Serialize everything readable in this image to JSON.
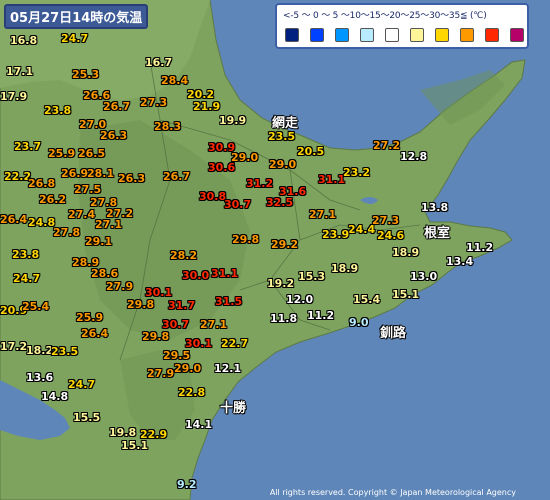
{
  "title": "05月27日14時の気温",
  "legend": {
    "scale_text": "<-5 〜 0 〜 5 〜10〜15〜20〜25〜30〜35≦ (℃)",
    "colors": [
      "#002080",
      "#0041ff",
      "#0096ff",
      "#b9ebff",
      "#ffffff",
      "#fff599",
      "#ffd700",
      "#ff9900",
      "#ff2800",
      "#b40068"
    ]
  },
  "places": [
    {
      "name": "網走"
    },
    {
      "name": "根室"
    },
    {
      "name": "釧路"
    },
    {
      "name": "十勝"
    }
  ],
  "temperatures": [
    "16.8",
    "24.7",
    "17.1",
    "25.3",
    "16.7",
    "28.4",
    "17.9",
    "26.6",
    "26.7",
    "27.3",
    "20.2",
    "21.9",
    "23.8",
    "27.0",
    "28.3",
    "19.9",
    "26.3",
    "23.5",
    "27.2",
    "23.7",
    "25.9",
    "26.5",
    "30.9",
    "29.0",
    "20.5",
    "12.8",
    "22.2",
    "26.9",
    "28.1",
    "30.6",
    "29.0",
    "26.8",
    "27.5",
    "26.3",
    "26.7",
    "31.2",
    "31.6",
    "31.1",
    "23.2",
    "26.2",
    "27.8",
    "30.8",
    "30.7",
    "32.5",
    "26.4",
    "27.4",
    "27.2",
    "27.1",
    "13.8",
    "24.8",
    "27.1",
    "27.3",
    "27.8",
    "24.4",
    "23.9",
    "24.6",
    "29.1",
    "29.8",
    "29.2",
    "23.8",
    "28.2",
    "18.9",
    "11.2",
    "28.9",
    "13.4",
    "28.6",
    "30.0",
    "31.1",
    "15.3",
    "18.9",
    "24.7",
    "27.9",
    "19.2",
    "13.0",
    "30.1",
    "15.4",
    "15.1",
    "20.9",
    "25.4",
    "29.8",
    "31.7",
    "31.5",
    "12.0",
    "25.9",
    "11.8",
    "11.2",
    "9.0",
    "30.7",
    "27.1",
    "26.4",
    "29.8",
    "22.7",
    "17.2",
    "30.1",
    "18.2",
    "23.5",
    "29.5",
    "12.1",
    "27.9",
    "29.0",
    "13.6",
    "24.7",
    "22.8",
    "14.8",
    "15.5",
    "14.1",
    "19.8",
    "22.9",
    "15.1",
    "9.2"
  ],
  "copyright": "All rights reserved. Copyright © Japan Meteorological Agency"
}
